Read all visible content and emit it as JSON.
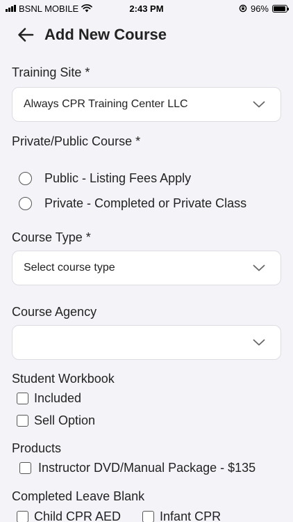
{
  "status_bar": {
    "carrier": "BSNL MOBILE",
    "time": "2:43 PM",
    "battery": "96%",
    "battery_level": 0.96
  },
  "header": {
    "title": "Add New Course"
  },
  "form": {
    "training_site": {
      "label": "Training Site *",
      "value": "Always CPR Training Center LLC"
    },
    "privacy": {
      "label": "Private/Public Course *",
      "options": [
        "Public - Listing Fees Apply",
        "Private - Completed or Private Class"
      ]
    },
    "course_type": {
      "label": "Course Type *",
      "placeholder": "Select course type"
    },
    "course_agency": {
      "label": "Course Agency",
      "value": ""
    },
    "student_workbook": {
      "label": "Student Workbook",
      "options": [
        "Included",
        "Sell Option"
      ]
    },
    "products": {
      "label": "Products",
      "options": [
        "Instructor DVD/Manual Package - $135"
      ]
    },
    "completed_leave_blank": {
      "label": "Completed Leave Blank",
      "options": [
        "Child CPR AED",
        "Infant CPR"
      ]
    }
  },
  "colors": {
    "background": "#f4f4f8",
    "field_border": "#dcdce3",
    "text": "#222222"
  }
}
